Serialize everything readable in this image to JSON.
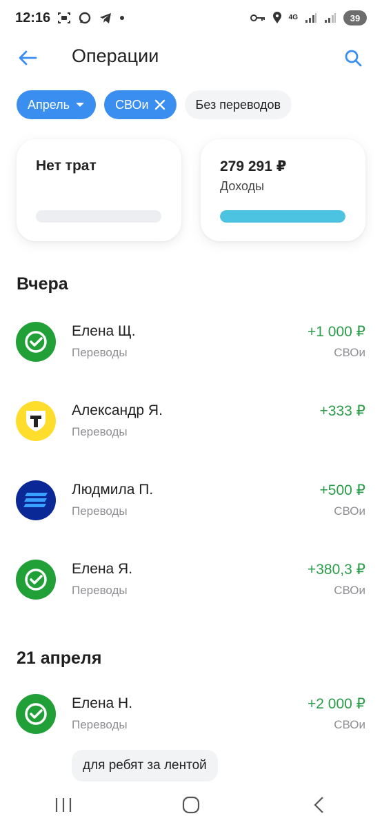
{
  "status_bar": {
    "time": "12:16",
    "network": "4G",
    "battery": "39"
  },
  "header": {
    "title": "Операции"
  },
  "filters": {
    "month_chip": "Апрель",
    "account_chip": "СВОи",
    "transfers_chip": "Без переводов"
  },
  "summary": {
    "expenses": {
      "title": "Нет трат",
      "fill": 0
    },
    "income": {
      "amount": "279 291 ₽",
      "label": "Доходы",
      "fill": 1.0
    }
  },
  "sections": [
    {
      "title": "Вчера",
      "operations": [
        {
          "name": "Елена Щ.",
          "category": "Переводы",
          "amount": "+1 000 ₽",
          "account": "СВОи",
          "bank_icon": "sber-icon"
        },
        {
          "name": "Александр Я.",
          "category": "Переводы",
          "amount": "+333 ₽",
          "account": "",
          "bank_icon": "tbank-icon"
        },
        {
          "name": "Людмила П.",
          "category": "Переводы",
          "amount": "+500 ₽",
          "account": "СВОи",
          "bank_icon": "vtb-icon"
        },
        {
          "name": "Елена Я.",
          "category": "Переводы",
          "amount": "+380,3 ₽",
          "account": "СВОи",
          "bank_icon": "sber-icon"
        }
      ]
    },
    {
      "title": "21 апреля",
      "operations": [
        {
          "name": "Елена Н.",
          "category": "Переводы",
          "amount": "+2 000 ₽",
          "account": "СВОи",
          "bank_icon": "sber-icon",
          "comment": "для ребят за лентой"
        }
      ]
    }
  ],
  "colors": {
    "accent": "#3a8ef0",
    "income": "#2a9d48",
    "income_bar": "#4cc3e0",
    "sber": "#21a038",
    "tbank": "#ffdd2d",
    "vtb": "#0a2896"
  }
}
